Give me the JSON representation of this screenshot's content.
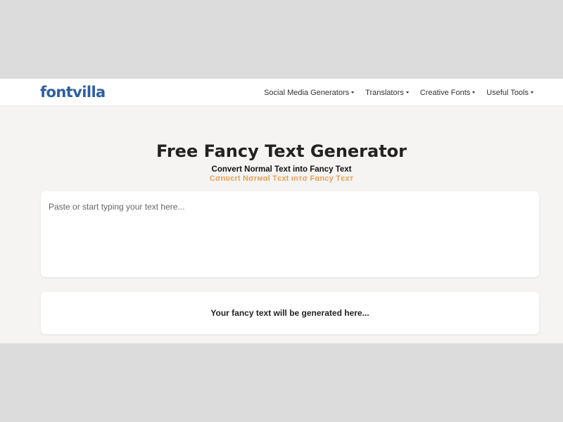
{
  "brand": {
    "logo": "fontvilla"
  },
  "nav": {
    "items": [
      {
        "label": "Social Media Generators"
      },
      {
        "label": "Translators"
      },
      {
        "label": "Creative Fonts"
      },
      {
        "label": "Useful Tools"
      }
    ]
  },
  "hero": {
    "title": "Free Fancy Text Generator",
    "subtitle": "Convert Normal Text into Fancy Text",
    "fancy_subtitle": "Cσnʋєrt Nσrмαl Tєxt ιnтσ Fαncy Tєxт"
  },
  "input": {
    "value": "",
    "placeholder": "Paste or start typing your text here..."
  },
  "output": {
    "placeholder": "Your fancy text will be generated here..."
  },
  "colors": {
    "brand": "#2e5ea3",
    "page_bg": "#f5f4f2",
    "fancy_accent": "#e8a15a"
  }
}
